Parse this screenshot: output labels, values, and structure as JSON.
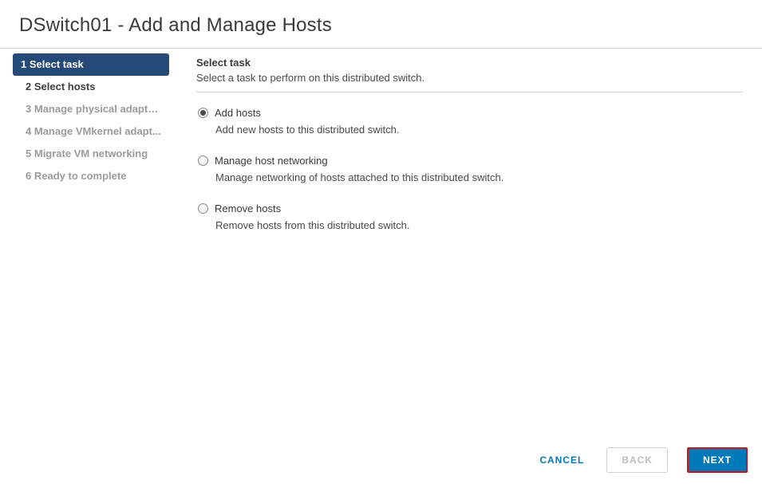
{
  "header": {
    "title": "DSwitch01 - Add and Manage Hosts"
  },
  "sidebar": {
    "steps": [
      {
        "num": "1",
        "label": "Select task",
        "state": "active"
      },
      {
        "num": "2",
        "label": "Select hosts",
        "state": "enabled"
      },
      {
        "num": "3",
        "label": "Manage physical adapters",
        "state": "disabled"
      },
      {
        "num": "4",
        "label": "Manage VMkernel adapt...",
        "state": "disabled"
      },
      {
        "num": "5",
        "label": "Migrate VM networking",
        "state": "disabled"
      },
      {
        "num": "6",
        "label": "Ready to complete",
        "state": "disabled"
      }
    ]
  },
  "main": {
    "title": "Select task",
    "description": "Select a task to perform on this distributed switch.",
    "options": [
      {
        "label": "Add hosts",
        "description": "Add new hosts to this distributed switch.",
        "selected": true
      },
      {
        "label": "Manage host networking",
        "description": "Manage networking of hosts attached to this distributed switch.",
        "selected": false
      },
      {
        "label": "Remove hosts",
        "description": "Remove hosts from this distributed switch.",
        "selected": false
      }
    ]
  },
  "footer": {
    "cancel": "CANCEL",
    "back": "BACK",
    "next": "NEXT"
  }
}
